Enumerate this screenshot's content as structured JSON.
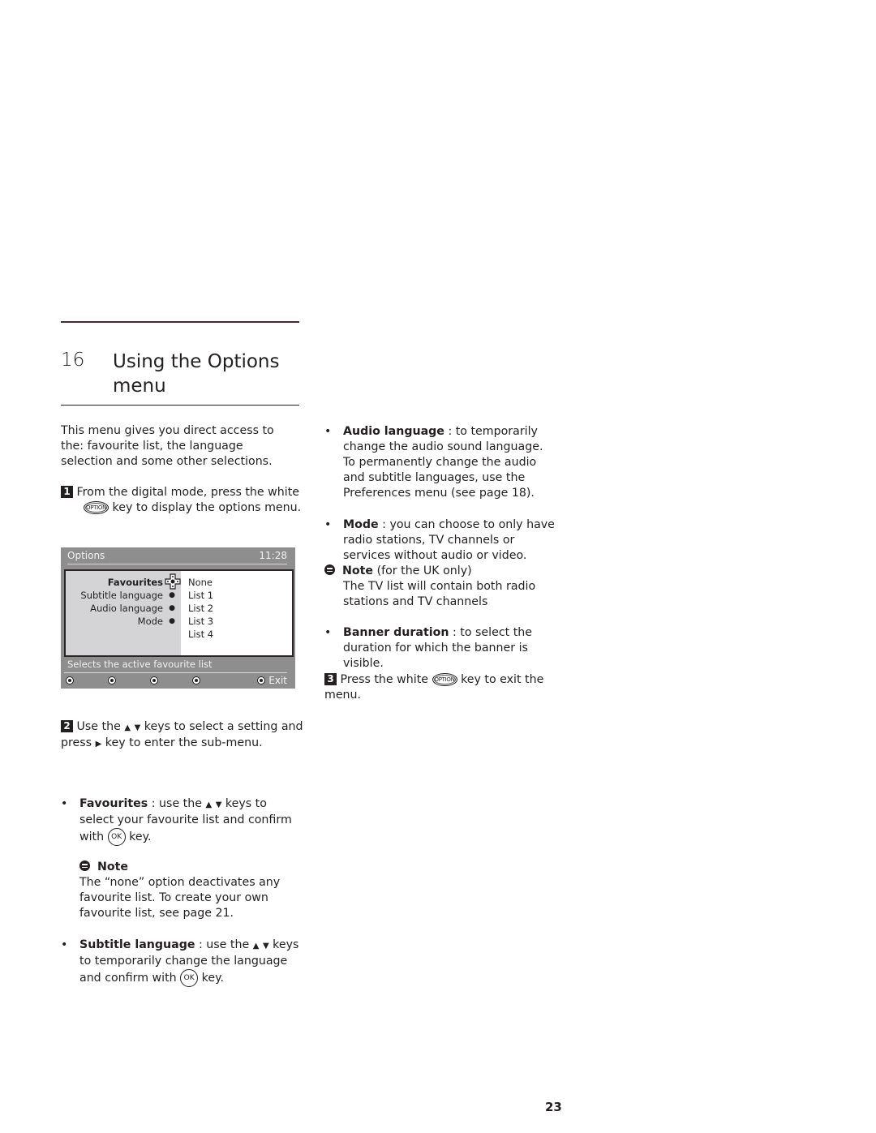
{
  "chapter": {
    "number": "16",
    "title_line1": "Using the Options",
    "title_line2": "menu"
  },
  "intro": "This menu gives you direct access to the: favourite list, the language selection and some other selections.",
  "steps": [
    {
      "num": "1",
      "before_key": "From the digital mode, press the white",
      "key": "OPTION",
      "after_key": "key to display the options menu."
    },
    {
      "num": "2",
      "text_a": "Use the",
      "up": "▲",
      "down": "▼",
      "text_b": "keys to select a setting and press",
      "right": "▶",
      "text_c": "key to enter the sub-menu."
    },
    {
      "num": "3",
      "before_key": "Press the white",
      "key": "OPTION",
      "after_key": "key to exit the menu."
    }
  ],
  "tv_menu": {
    "title": "Options",
    "time": "11:28",
    "items": [
      {
        "label": "Favourites",
        "active": true
      },
      {
        "label": "Subtitle language"
      },
      {
        "label": "Audio language"
      },
      {
        "label": "Mode"
      }
    ],
    "options": [
      "None",
      "List 1",
      "List 2",
      "List 3",
      "List 4"
    ],
    "help": "Selects the active favourite list",
    "exit_label": "Exit",
    "colors": {
      "frame": "#8e8e8e",
      "left_panel": "#d4d4d6",
      "right_panel": "#ffffff"
    }
  },
  "bullets": {
    "favourites": {
      "term": "Favourites",
      "a": ": use the",
      "b": "keys to select your favourite list and confirm with",
      "key": "OK",
      "c": "key."
    },
    "favourites_note": {
      "title": "Note",
      "text": "The “none” option deactivates any favourite list. To create your own favourite list, see page 21."
    },
    "subtitle": {
      "term": "Subtitle language",
      "a": ": use the",
      "b": "keys to temporarily change the language and confirm with",
      "key": "OK",
      "c": "key."
    },
    "audio": {
      "term": "Audio language",
      "text": ": to temporarily change the audio sound language.",
      "text2": "To permanently change the audio and subtitle languages, use the Preferences menu (see page 18)."
    },
    "mode": {
      "term": "Mode",
      "text": ": you can choose to only have radio stations, TV channels or services without audio or video."
    },
    "mode_note": {
      "title": "Note",
      "qualifier": "(for the UK only)",
      "text": "The TV list will contain both radio stations and TV channels"
    },
    "banner": {
      "term": "Banner duration",
      "text": ": to select the duration for which the banner is visible."
    }
  },
  "arrows": {
    "up": "▲",
    "down": "▼",
    "bullet": "•"
  },
  "page_number": "23"
}
